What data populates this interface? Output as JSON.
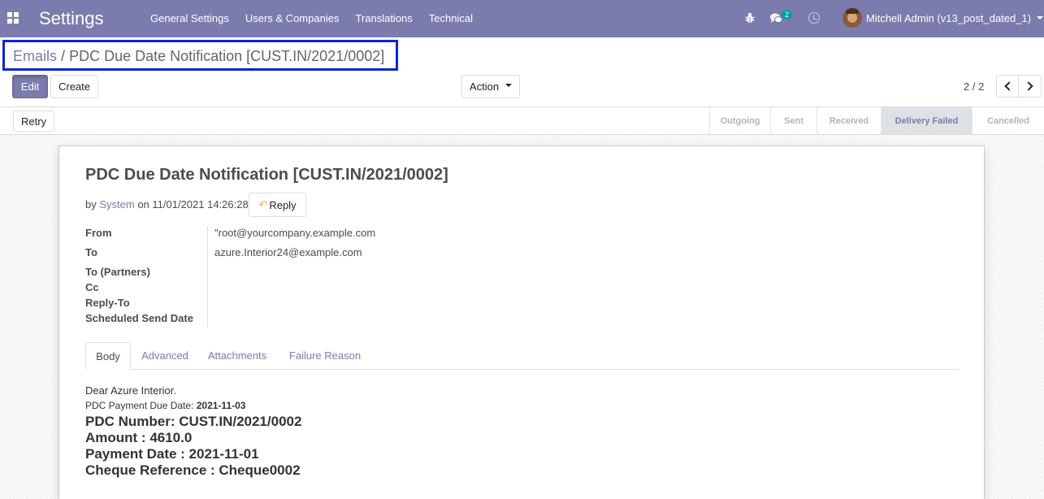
{
  "navbar": {
    "app_name": "Settings",
    "menu": [
      "General Settings",
      "Users & Companies",
      "Translations",
      "Technical"
    ],
    "chat_count": "2",
    "user_name": "Mitchell Admin (v13_post_dated_1)",
    "accent_color": "#7c7bad"
  },
  "breadcrumb": {
    "parent": "Emails",
    "separator": "/",
    "current": "PDC Due Date Notification [CUST.IN/2021/0002]"
  },
  "controls": {
    "edit_label": "Edit",
    "create_label": "Create",
    "action_label": "Action",
    "pager": "2 / 2"
  },
  "statusbar": {
    "retry_label": "Retry",
    "stages": [
      "Outgoing",
      "Sent",
      "Received",
      "Delivery Failed",
      "Cancelled"
    ],
    "active_stage": "Delivery Failed"
  },
  "mail": {
    "subject": "PDC Due Date Notification [CUST.IN/2021/0002]",
    "by_prefix": "by",
    "author": "System",
    "on_text": "on 11/01/2021 14:26:28",
    "reply_label": "Reply",
    "fields": {
      "from_label": "From",
      "from_value": "\"root@yourcompany.example.com",
      "to_label": "To",
      "to_value": "azure.Interior24@example.com",
      "to_partners_label": "To (Partners)",
      "cc_label": "Cc",
      "reply_to_label": "Reply-To",
      "scheduled_label": "Scheduled Send Date"
    },
    "tabs": [
      "Body",
      "Advanced",
      "Attachments",
      "Failure Reason"
    ],
    "active_tab": "Body",
    "body": {
      "greeting": "Dear Azure Interior.",
      "due_date_label": "PDC Payment Due Date:",
      "due_date_value": "2021-11-03",
      "pdc_number": "PDC Number: CUST.IN/2021/0002",
      "amount": "Amount : 4610.0",
      "payment_date": "Payment Date : 2021-11-01",
      "cheque_ref": "Cheque Reference : Cheque0002"
    }
  },
  "icons": [
    "apps-icon",
    "bug-icon",
    "chat-icon",
    "clock-icon",
    "avatar",
    "chevron-left-icon",
    "chevron-right-icon",
    "reply-icon"
  ]
}
